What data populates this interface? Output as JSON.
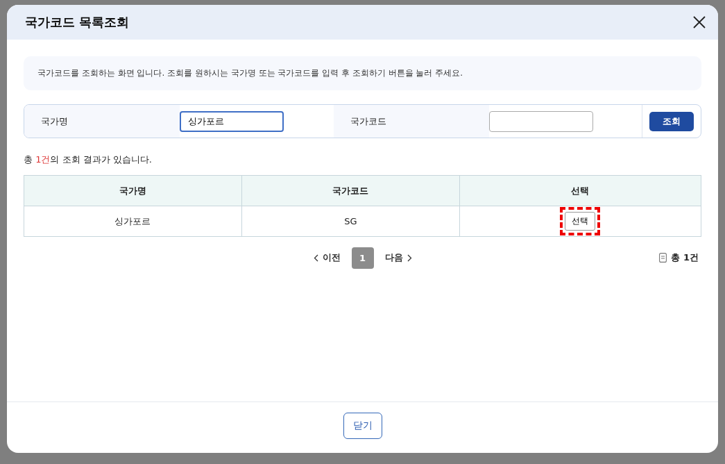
{
  "dialog": {
    "title": "국가코드 목록조회",
    "info": "국가코드를 조회하는 화면 입니다. 조회를 원하시는 국가명 또는 국가코드를 입력 후 조회하기 버튼을 눌러 주세요.",
    "search": {
      "fields": [
        {
          "label": "국가명",
          "value": "싱가포르",
          "focused": true
        },
        {
          "label": "국가코드",
          "focused": false
        }
      ],
      "button": "조회"
    },
    "result_summary": "총 **1건**의 조회 결과가 있습니다.",
    "table": {
      "columns": [
        "국가명",
        "국가코드",
        "선택"
      ],
      "rows": [
        {
          "name": "싱가포르",
          "code": "SG",
          "action": "선택",
          "highlighted": true
        }
      ]
    },
    "pagination": {
      "prev": "이전",
      "pages": [
        {
          "label": "1",
          "selected": true
        }
      ],
      "next": "다음",
      "total": "총 1건"
    },
    "close_button": "닫기"
  }
}
